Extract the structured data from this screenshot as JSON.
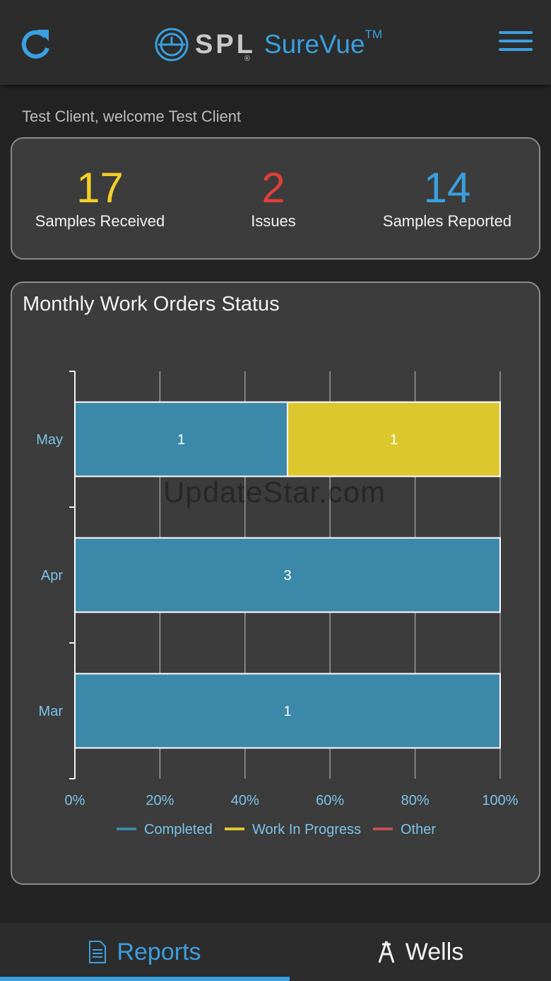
{
  "header": {
    "logo_spl": "SPL",
    "logo_reg": "®",
    "logo_product": "SureVue",
    "logo_tm": "TM",
    "accent_color": "#3aa0e0"
  },
  "welcome": "Test Client, welcome Test Client",
  "stats": [
    {
      "value": "17",
      "label": "Samples Received",
      "color": "#f2cf2a"
    },
    {
      "value": "2",
      "label": "Issues",
      "color": "#e0403a"
    },
    {
      "value": "14",
      "label": "Samples Reported",
      "color": "#3aa0e0"
    }
  ],
  "watermark": "UpdateStar.com",
  "chart_data": {
    "type": "bar",
    "orientation": "horizontal",
    "stacked": "percent",
    "title": "Monthly Work Orders Status",
    "categories": [
      "May",
      "Apr",
      "Mar"
    ],
    "series": [
      {
        "name": "Completed",
        "color": "#3c88a8",
        "values": [
          1,
          3,
          1
        ]
      },
      {
        "name": "Work In Progress",
        "color": "#dcc72f",
        "values": [
          1,
          0,
          0
        ]
      },
      {
        "name": "Other",
        "color": "#c0504d",
        "values": [
          0,
          0,
          0
        ]
      }
    ],
    "xticks": [
      "0%",
      "20%",
      "40%",
      "60%",
      "80%",
      "100%"
    ],
    "xlim": [
      0,
      100
    ],
    "grid": true,
    "legend": "bottom"
  },
  "tabs": [
    {
      "label": "Reports",
      "icon": "document-icon",
      "active": true
    },
    {
      "label": "Wells",
      "icon": "well-rig-icon",
      "active": false
    }
  ]
}
